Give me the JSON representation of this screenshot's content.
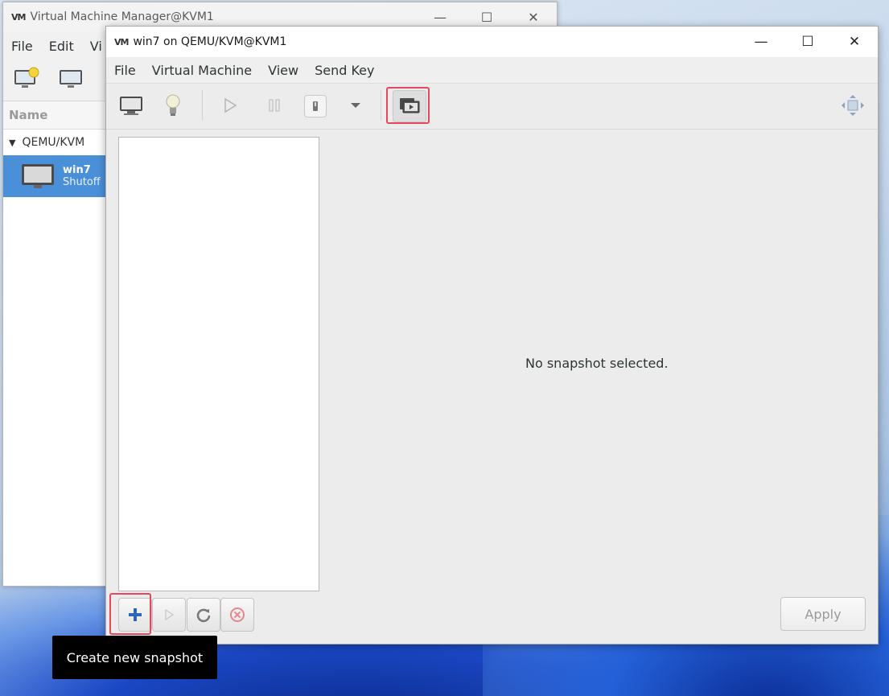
{
  "back_window": {
    "title": "Virtual Machine Manager@KVM1",
    "logo": "VM",
    "menus": [
      "File",
      "Edit",
      "Vi"
    ],
    "list_header": "Name",
    "group": "QEMU/KVM",
    "vm": {
      "name": "win7",
      "status": "Shutoff"
    }
  },
  "front_window": {
    "title": "win7 on QEMU/KVM@KVM1",
    "logo": "VM",
    "menus": [
      "File",
      "Virtual Machine",
      "View",
      "Send Key"
    ],
    "detail_message": "No snapshot selected.",
    "apply_label": "Apply"
  },
  "tooltip": "Create new snapshot",
  "colors": {
    "highlight": "#e5475b",
    "selection": "#4a90d9"
  },
  "icons": [
    "console-icon",
    "details-icon",
    "run-icon",
    "pause-icon",
    "shutdown-icon",
    "dropdown-icon",
    "snapshots-icon",
    "fullscreen-icon",
    "add-icon",
    "start-icon",
    "refresh-icon",
    "delete-icon"
  ]
}
